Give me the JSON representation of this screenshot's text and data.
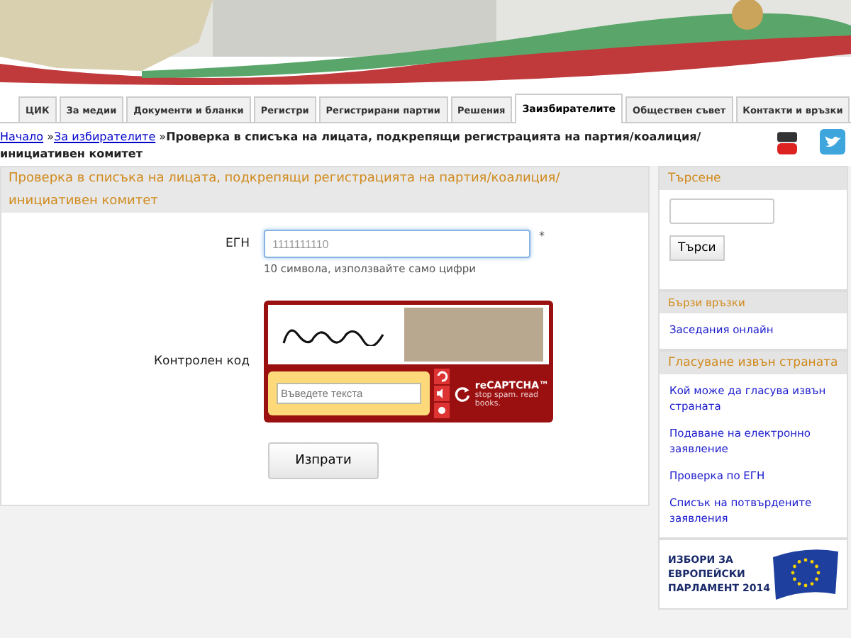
{
  "tabs": [
    {
      "label": "ЦИК",
      "selected": false
    },
    {
      "label": "За медии",
      "selected": false
    },
    {
      "label": "Документи и бланки",
      "selected": false
    },
    {
      "label": "Регистри",
      "selected": false
    },
    {
      "label": "Регистрирани партии",
      "selected": false
    },
    {
      "label": "Решения",
      "selected": false
    },
    {
      "label": "Заизбирателите",
      "selected": true
    },
    {
      "label": "Обществен съвет",
      "selected": false
    },
    {
      "label": "Контакти и връзки",
      "selected": false
    }
  ],
  "breadcrumb": {
    "links": [
      "Начало",
      "За избирателите"
    ],
    "separator": "»",
    "current": "Проверка в списъка на лицата, подкрепящи регистрацията на партия/коалиция/инициативен комитет"
  },
  "form": {
    "title": "Проверка в списъка на лицата, подкрепящи регистрацията на партия/коалиция/инициативен комитет",
    "egn": {
      "label": "ЕГН",
      "placeholder": "1111111110",
      "required_mark": "*",
      "hint": "10 символа, използвайте само цифри"
    },
    "captcha": {
      "label": "Контролен код",
      "placeholder": "Въведете текста",
      "logo": "reCAPTCHA™",
      "tagline": "stop spam. read books."
    },
    "submit": "Изпрати"
  },
  "sidebar": {
    "search": {
      "title": "Търсене",
      "button": "Търси"
    },
    "quick_links": {
      "title": "Бързи връзки",
      "links": [
        "Заседания онлайн"
      ]
    },
    "abroad": {
      "title": "Гласуване извън страната",
      "links": [
        "Кой може да гласува извън страната",
        "Подаване на електронно заявление",
        "Проверка по ЕГН",
        "Списък на потвърдените заявления"
      ]
    },
    "banner": [
      "ИЗБОРИ ЗА",
      "ЕВРОПЕЙСКИ",
      "ПАРЛАМЕНТ 2014"
    ]
  }
}
